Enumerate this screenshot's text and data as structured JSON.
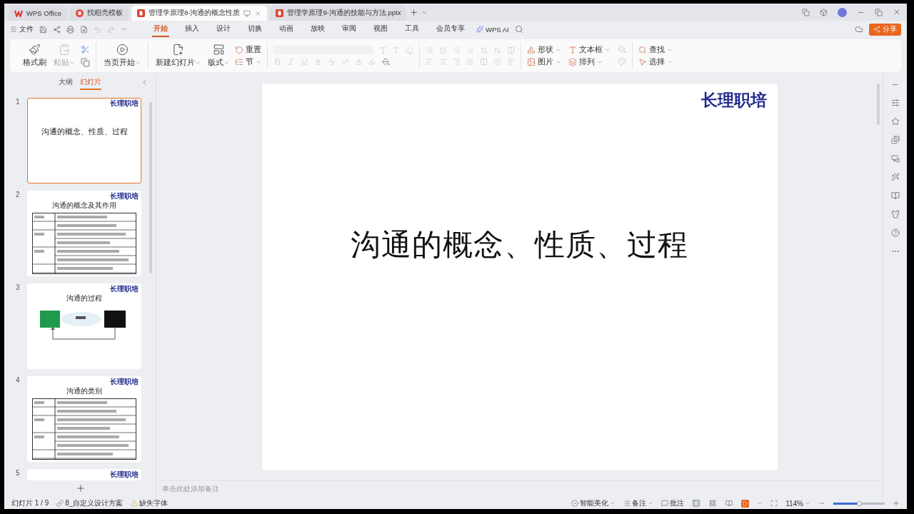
{
  "tabs": [
    {
      "label": "WPS Office",
      "kind": "home",
      "selected": false
    },
    {
      "label": "找稻壳模板",
      "kind": "template",
      "selected": false
    },
    {
      "label": "管理学原理8-沟通的概念性质",
      "kind": "doc",
      "selected": true
    },
    {
      "label": "管理学原理9-沟通的技能与方法.pptx",
      "kind": "doc",
      "selected": false
    }
  ],
  "menu": {
    "file": "文件",
    "tabs": [
      {
        "label": "开始",
        "selected": true
      },
      {
        "label": "插入",
        "selected": false
      },
      {
        "label": "设计",
        "selected": false
      },
      {
        "label": "切换",
        "selected": false
      },
      {
        "label": "动画",
        "selected": false
      },
      {
        "label": "放映",
        "selected": false
      },
      {
        "label": "审阅",
        "selected": false
      },
      {
        "label": "视图",
        "selected": false
      },
      {
        "label": "工具",
        "selected": false
      },
      {
        "label": "会员专享",
        "selected": false
      }
    ],
    "ai": "WPS AI",
    "share": "分享"
  },
  "ribbon": {
    "clipboard": [
      {
        "label": "格式刷",
        "caret": false,
        "disabled": false
      },
      {
        "label": "粘贴",
        "caret": true,
        "disabled": true
      }
    ],
    "show": [
      {
        "label": "当页开始",
        "caret": true
      }
    ],
    "slides": [
      {
        "label": "新建幻灯片",
        "caret": true
      },
      {
        "label": "版式",
        "caret": true
      }
    ],
    "slide_small": [
      {
        "label": "重置",
        "caret": false
      },
      {
        "label": "节",
        "caret": true
      }
    ],
    "draw": [
      {
        "label": "形状",
        "caret": true
      },
      {
        "label": "图片",
        "caret": true
      },
      {
        "label": "文本框",
        "caret": true
      },
      {
        "label": "排列",
        "caret": true
      }
    ],
    "edit": [
      {
        "label": "查找",
        "caret": true
      },
      {
        "label": "选择",
        "caret": true
      }
    ]
  },
  "panel": {
    "tabs": [
      {
        "label": "大纲",
        "selected": false
      },
      {
        "label": "幻灯片",
        "selected": true
      }
    ],
    "thumbnails": [
      {
        "number": "1",
        "selected": true,
        "kind": "title",
        "logo": "长理职培",
        "title": "沟通的概念、性质、过程"
      },
      {
        "number": "2",
        "selected": false,
        "kind": "table",
        "logo": "长理职培",
        "title": "沟通的概念及其作用"
      },
      {
        "number": "3",
        "selected": false,
        "kind": "diagram",
        "logo": "长理职培",
        "title": "沟通的过程"
      },
      {
        "number": "4",
        "selected": false,
        "kind": "table",
        "logo": "长理职培",
        "title": "沟通的类别"
      },
      {
        "number": "5",
        "selected": false,
        "kind": "cut",
        "logo": "长理职培"
      }
    ]
  },
  "slide": {
    "logo": "长理职培",
    "title": "沟通的概念、性质、过程"
  },
  "notes": {
    "placeholder": "单击此处添加备注"
  },
  "status_bar": {
    "slide_count": "幻灯片 1 / 9",
    "theme": "8_自定义设计方案",
    "missing_fonts": "缺失字体",
    "beautify": "智能美化",
    "notes": "备注",
    "comments": "批注",
    "views": [
      {
        "kind": "normal",
        "selected": true
      },
      {
        "kind": "sorter",
        "selected": false
      },
      {
        "kind": "reading",
        "selected": false
      }
    ],
    "zoom": "114%",
    "zoom_slider": {
      "level": 0.5
    }
  }
}
